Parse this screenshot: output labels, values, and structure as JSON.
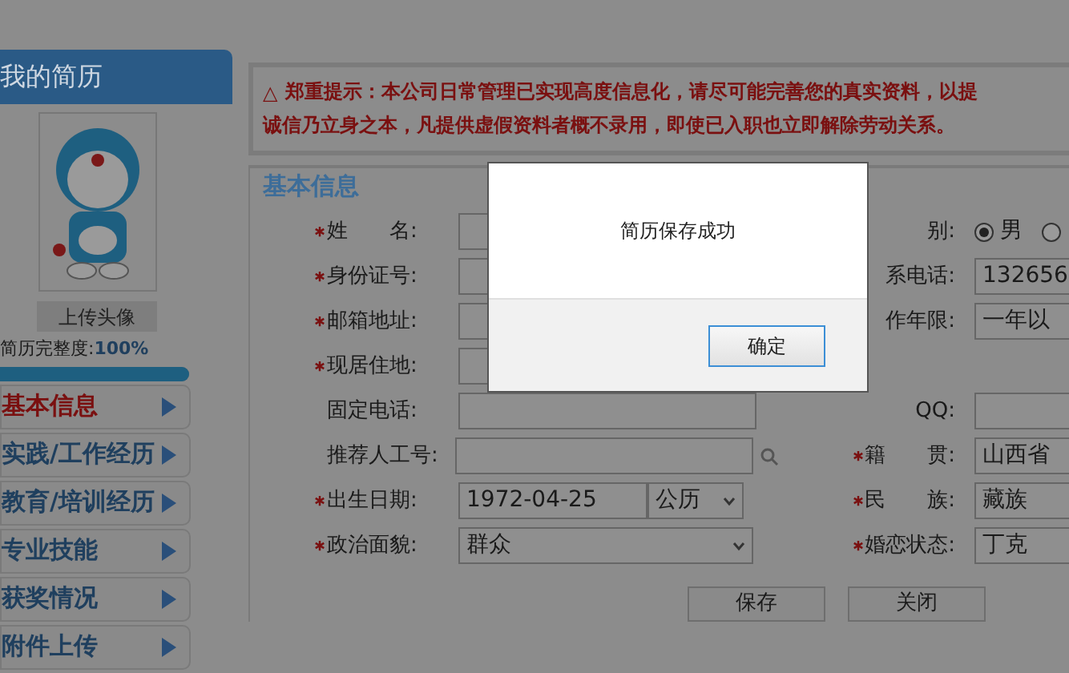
{
  "sidebar": {
    "title": "我的简历",
    "upload_button": "上传头像",
    "completeness_label": "简历完整度:",
    "completeness_value": "100%",
    "level": 1,
    "items": [
      {
        "label": "基本信息",
        "selected": true
      },
      {
        "label": "实践/工作经历",
        "selected": false
      },
      {
        "label": "教育/培训经历",
        "selected": false
      },
      {
        "label": "专业技能",
        "selected": false
      },
      {
        "label": "获奖情况",
        "selected": false
      },
      {
        "label": "附件上传",
        "selected": false
      }
    ]
  },
  "notice": {
    "icon": "△",
    "lines": [
      "郑重提示：本公司日常管理已实现高度信息化，请尽可能完善您的真实资料，以提",
      "诚信乃立身之本，凡提供虚假资料者概不录用，即使已入职也立即解除劳动关系。"
    ]
  },
  "section_title": "基本信息",
  "left_fields": [
    {
      "label": "姓　　名:",
      "required": true,
      "kind": "input"
    },
    {
      "label": "身份证号:",
      "required": true,
      "kind": "input"
    },
    {
      "label": "邮箱地址:",
      "required": true,
      "kind": "input"
    },
    {
      "label": "现居住地:",
      "required": true,
      "kind": "input"
    },
    {
      "label": "固定电话:",
      "required": false,
      "kind": "input"
    },
    {
      "label": "推荐人工号:",
      "required": false,
      "kind": "search"
    },
    {
      "label": "出生日期:",
      "required": true,
      "kind": "date",
      "value": "1972-04-25",
      "calendar": "公历"
    },
    {
      "label": "政治面貌:",
      "required": true,
      "kind": "select",
      "value": "群众"
    }
  ],
  "right_fields": [
    {
      "label": "别:",
      "required": false,
      "kind": "radio",
      "options": [
        {
          "label": "男",
          "selected": true
        },
        {
          "selected": false
        }
      ]
    },
    {
      "label": "系电话:",
      "required": false,
      "kind": "input",
      "value": "132656"
    },
    {
      "label": "作年限:",
      "required": false,
      "kind": "input",
      "value": "一年以"
    },
    {
      "kind": "blank"
    },
    {
      "label": "QQ:",
      "required": false,
      "kind": "input"
    },
    {
      "label": "籍　　贯:",
      "required": true,
      "kind": "input",
      "value": "山西省"
    },
    {
      "label": "民　　族:",
      "required": true,
      "kind": "input",
      "value": "藏族"
    },
    {
      "label": "婚恋状态:",
      "required": true,
      "kind": "input",
      "value": "丁克"
    }
  ],
  "buttons": [
    "保存",
    "关闭"
  ],
  "dialog": {
    "message": "简历保存成功",
    "button": "确定"
  }
}
